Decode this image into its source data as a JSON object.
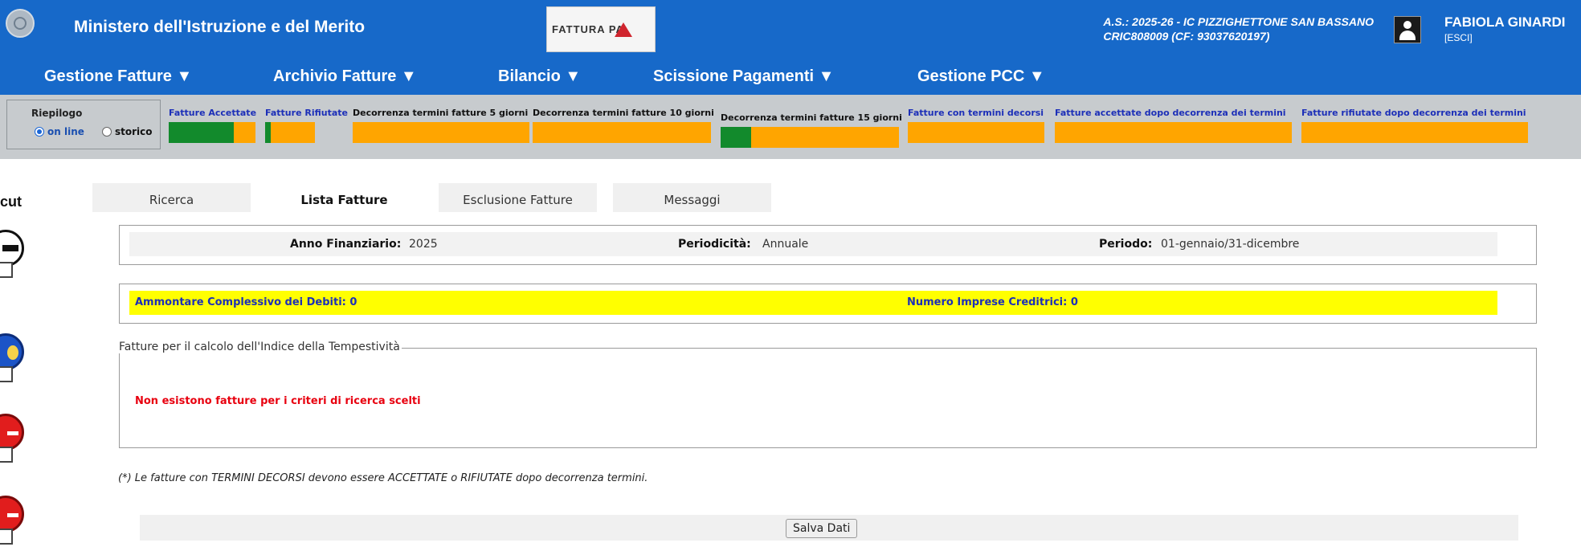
{
  "header": {
    "ministry": "Ministero dell'Istruzione e del Merito",
    "logo_text": "FATTURA PA",
    "school_line1": "A.S.: 2025-26  - IC PIZZIGHETTONE SAN BASSANO",
    "school_line2": "CRIC808009  (CF: 93037620197)",
    "user_name": "FABIOLA GINARDI",
    "logout": "[ESCI]",
    "colors": {
      "bar": "#1769c9",
      "text": "#ffffff"
    }
  },
  "menu": [
    {
      "label": "Gestione Fatture ▼"
    },
    {
      "label": "Archivio Fatture ▼"
    },
    {
      "label": "Bilancio ▼"
    },
    {
      "label": "Scissione Pagamenti ▼"
    },
    {
      "label": "Gestione PCC ▼"
    }
  ],
  "summary": {
    "title": "Riepilogo",
    "mode_online": "on line",
    "mode_history": "storico",
    "selected_mode": "on line",
    "stats": [
      {
        "label": "Fatture Accettate",
        "fill": 0.75,
        "color": "#1c2fb8"
      },
      {
        "label": "Fatture Rifiutate",
        "fill": 0.12,
        "color": "#1c2fb8"
      },
      {
        "label": "Decorrenza termini fatture 5 giorni",
        "fill": 0,
        "color": "#111111"
      },
      {
        "label": "Decorrenza termini fatture 10 giorni",
        "fill": 0,
        "color": "#111111"
      },
      {
        "label": "Decorrenza termini fatture 15 giorni",
        "fill": 0.17,
        "color": "#111111"
      },
      {
        "label": "Fatture con termini decorsi",
        "fill": 0,
        "color": "#1c2fb8"
      },
      {
        "label": "Fatture accettate dopo decorrenza dei termini",
        "fill": 0,
        "color": "#1c2fb8"
      },
      {
        "label": "Fatture rifiutate dopo decorrenza dei termini",
        "fill": 0,
        "color": "#1c2fb8"
      }
    ],
    "bar_colors": {
      "track": "#ffa500",
      "fill": "#128a2c"
    }
  },
  "sidebar": {
    "label_fragment": "cut",
    "icons": [
      "back-icon",
      "euro-icon",
      "red-doc-icon",
      "red-doc-icon"
    ]
  },
  "tabs": [
    {
      "label": "Ricerca",
      "active": false
    },
    {
      "label": "Lista Fatture",
      "active": true
    },
    {
      "label": "Esclusione Fatture",
      "active": false
    },
    {
      "label": "Messaggi",
      "active": false
    }
  ],
  "info": {
    "anno_label": "Anno Finanziario:",
    "anno_value": "2025",
    "periodicita_label": "Periodicità:",
    "periodicita_value": "Annuale",
    "periodo_label": "Periodo:",
    "periodo_value": "01-gennaio/31-dicembre"
  },
  "debits": {
    "total_label": "Ammontare Complessivo dei Debiti: 0",
    "creditors_label": "Numero Imprese Creditrici: 0"
  },
  "fatture_section": {
    "legend": "Fatture per il calcolo dell'Indice della Tempestività",
    "empty_message": "Non esistono fatture per i criteri di ricerca scelti"
  },
  "footnote": "(*) Le fatture con TERMINI DECORSI devono essere ACCETTATE o RIFIUTATE dopo decorrenza termini.",
  "save_button": "Salva Dati"
}
